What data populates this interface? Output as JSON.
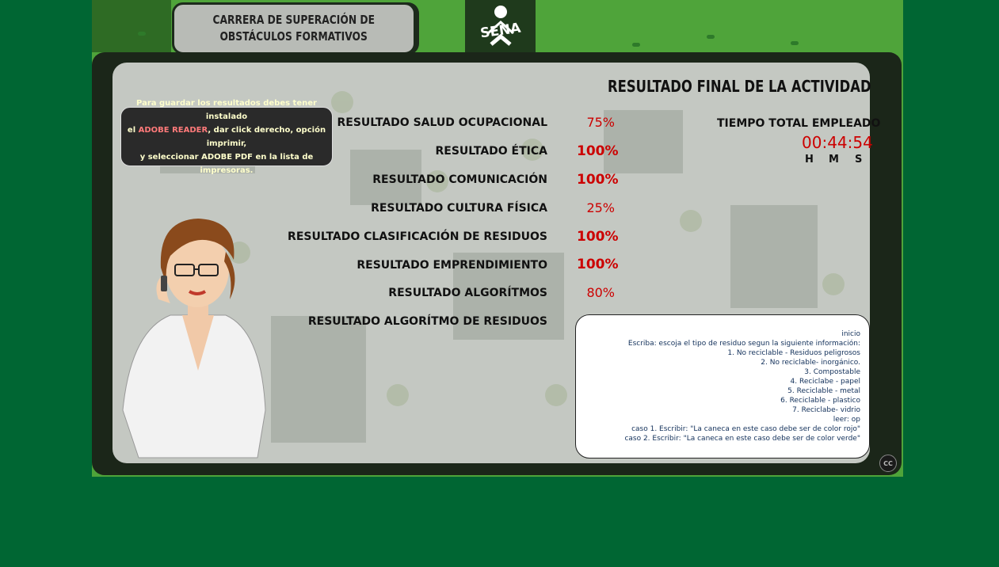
{
  "header": {
    "title_line1": "CARRERA DE SUPERACIÓN DE",
    "title_line2": "OBSTÁCULOS FORMATIVOS",
    "logo_text": "SENA"
  },
  "info_box": {
    "line1": "Para guardar los resultados debes tener instalado",
    "line2_pre": "el ",
    "line2_highlight": "ADOBE READER",
    "line2_post": ", dar click derecho,  opción imprimir,",
    "line3": "y seleccionar ADOBE PDF en la lista de impresoras."
  },
  "results_title": "RESULTADO FINAL DE LA ACTIVIDAD",
  "results": [
    {
      "label": "RESULTADO SALUD OCUPACIONAL",
      "value": "75%"
    },
    {
      "label": "RESULTADO ÉTICA",
      "value": "100%"
    },
    {
      "label": "RESULTADO COMUNICACIÓN",
      "value": "100%"
    },
    {
      "label": "RESULTADO CULTURA FÍSICA",
      "value": "25%"
    },
    {
      "label": "RESULTADO CLASIFICACIÓN DE RESIDUOS",
      "value": "100%"
    },
    {
      "label": "RESULTADO EMPRENDIMIENTO",
      "value": "100%"
    },
    {
      "label": "RESULTADO ALGORÍTMOS",
      "value": "80%"
    },
    {
      "label": "RESULTADO ALGORÍTMO DE RESIDUOS",
      "value": ""
    }
  ],
  "time": {
    "label": "TIEMPO TOTAL EMPLEADO",
    "value": "00:44:54",
    "h": "H",
    "m": "M",
    "s": "S"
  },
  "algorithm_lines": [
    "inicio",
    "Escriba: escoja el tipo de residuo segun la siguiente información:",
    "1. No reciclable - Residuos peligrosos",
    "2. No reciclable- inorgánico.",
    "3. Compostable",
    "4. Reciclabe - papel",
    "5. Reciclable - metal",
    "6. Reciclable - plastico",
    "7. Reciclabe- vidrio",
    "leer: op",
    "caso 1. Escribir: \"La caneca en este caso debe ser de color rojo\"",
    "caso 2. Escribir: \"La caneca en este caso debe ser de color verde\""
  ],
  "cc_label": "CC",
  "colors": {
    "background": "#006633",
    "value_red": "#cc0000",
    "panel": "#c4c8c2"
  }
}
